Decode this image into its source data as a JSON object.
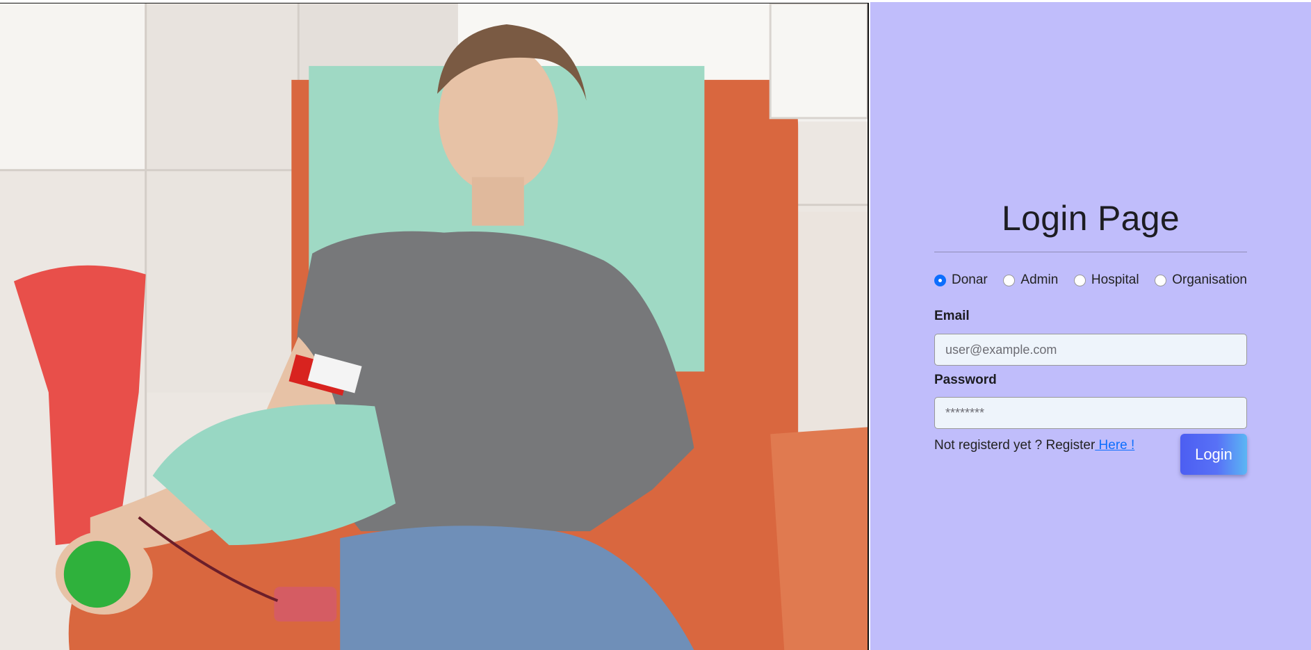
{
  "login": {
    "title": "Login Page",
    "roles": [
      {
        "label": "Donar",
        "checked": true
      },
      {
        "label": "Admin",
        "checked": false
      },
      {
        "label": "Hospital",
        "checked": false
      },
      {
        "label": "Organisation",
        "checked": false
      }
    ],
    "email": {
      "label": "Email",
      "placeholder": "user@example.com",
      "value": ""
    },
    "password": {
      "label": "Password",
      "placeholder": "********",
      "value": ""
    },
    "register_text": "Not registerd yet ? Register",
    "register_link": " Here !",
    "login_button": "Login"
  },
  "theme": {
    "panel_bg": "#c0bdfb",
    "accent": "#0d6efd",
    "button_gradient": [
      "#4c5ef2",
      "#5bb6f4"
    ]
  }
}
